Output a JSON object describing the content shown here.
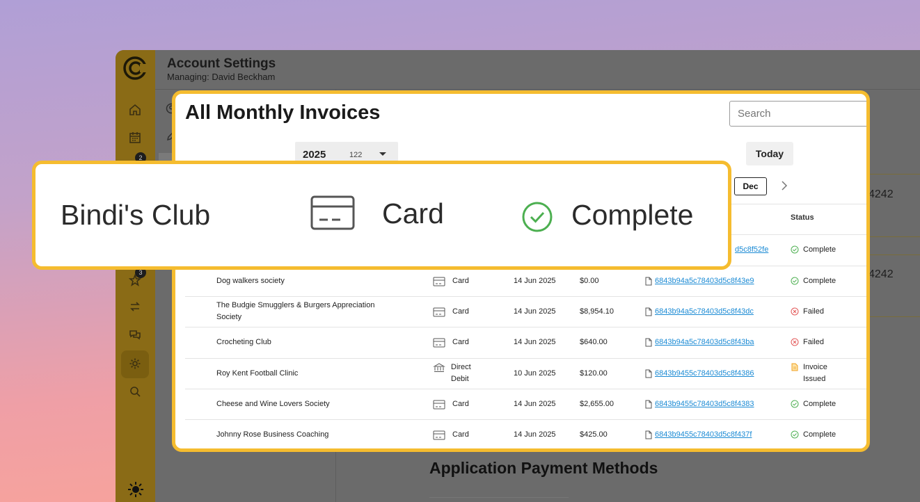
{
  "header": {
    "title": "Account Settings",
    "subtitle": "Managing: David Beckham"
  },
  "rail": {
    "badge_top": "2",
    "badge_star": "3"
  },
  "background": {
    "right_values": [
      "4242",
      "4242"
    ],
    "section_title": "Application Payment Methods"
  },
  "invoices": {
    "title": "All Monthly Invoices",
    "search_placeholder": "Search",
    "year": "2025",
    "year_count": "122",
    "today_label": "Today",
    "selected_month": "Dec",
    "status_header": "Status",
    "partial_row": {
      "invoice_tail": "d5c8f52fe",
      "status": "Complete"
    },
    "rows": [
      {
        "name": "Dog walkers society",
        "method": "Card",
        "date": "14 Jun 2025",
        "amount": "$0.00",
        "invoice": "6843b94a5c78403d5c8f43e9",
        "status": "Complete"
      },
      {
        "name": "The Budgie Smugglers & Burgers Appreciation Society",
        "method": "Card",
        "date": "14 Jun 2025",
        "amount": "$8,954.10",
        "invoice": "6843b94a5c78403d5c8f43dc",
        "status": "Failed"
      },
      {
        "name": "Crocheting Club",
        "method": "Card",
        "date": "14 Jun 2025",
        "amount": "$640.00",
        "invoice": "6843b94a5c78403d5c8f43ba",
        "status": "Failed"
      },
      {
        "name": "Roy Kent Football Clinic",
        "method": "Direct Debit",
        "date": "10 Jun 2025",
        "amount": "$120.00",
        "invoice": "6843b9455c78403d5c8f4386",
        "status": "Invoice Issued"
      },
      {
        "name": "Cheese and Wine Lovers Society",
        "method": "Card",
        "date": "14 Jun 2025",
        "amount": "$2,655.00",
        "invoice": "6843b9455c78403d5c8f4383",
        "status": "Complete"
      },
      {
        "name": "Johnny Rose Business Coaching",
        "method": "Card",
        "date": "14 Jun 2025",
        "amount": "$425.00",
        "invoice": "6843b9455c78403d5c8f437f",
        "status": "Complete"
      }
    ]
  },
  "zoom": {
    "name": "Bindi's Club",
    "method": "Card",
    "status": "Complete"
  },
  "colors": {
    "highlight": "#f5bc2f",
    "link": "#1a8ad4",
    "complete": "#4caf50",
    "failed": "#e25555",
    "issued": "#f0a020",
    "rail": "#8a6b16"
  }
}
